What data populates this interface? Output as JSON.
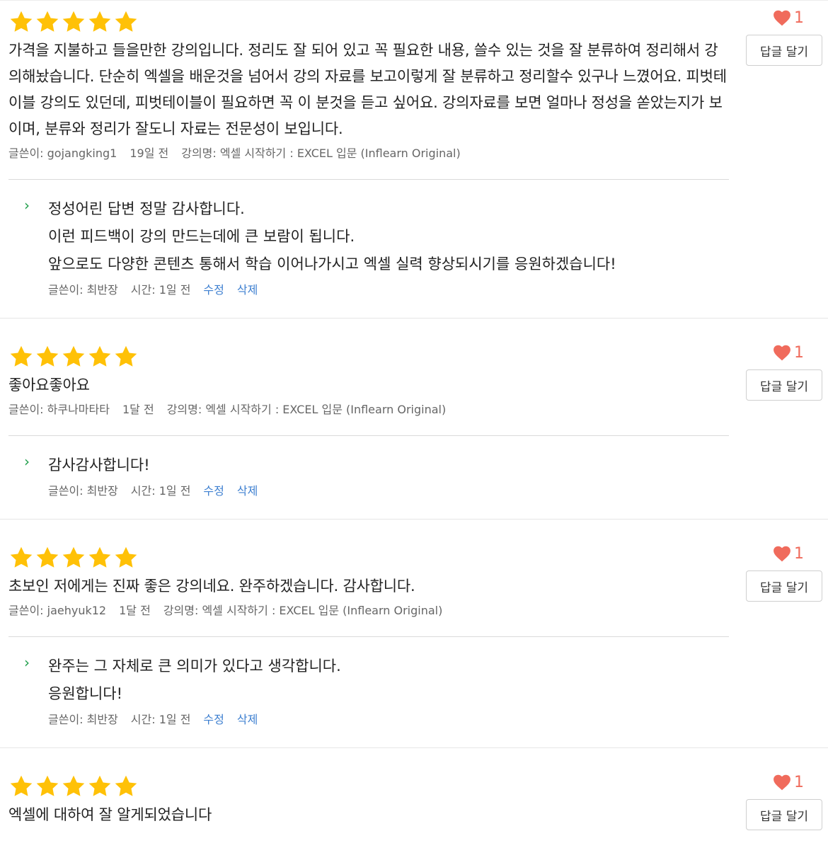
{
  "reviews": [
    {
      "rating": 5,
      "body": "가격을 지불하고 들을만한 강의입니다. 정리도 잘 되어 있고 꼭 필요한 내용, 쓸수 있는 것을 잘 분류하여 정리해서 강의해놨습니다. 단순히 엑셀을 배운것을 넘어서 강의 자료를 보고이렇게 잘 분류하고 정리할수 있구나 느꼈어요. 피벗테이블 강의도 있던데, 피벗테이블이 필요하면 꼭 이 분것을 듣고 싶어요. 강의자료를 보면 얼마나 정성을 쏟았는지가 보이며, 분류와 정리가 잘도니 자료는 전문성이 보입니다.",
      "author": "글쓴이: gojangking1",
      "time": "19일 전",
      "course": "강의명: 엑셀 시작하기 : EXCEL 입문 (Inflearn Original)",
      "likes": "1",
      "reply_button": "답글 달기",
      "reply": {
        "lines": [
          "정성어린 답변 정말 감사합니다.",
          "이런 피드백이 강의 만드는데에 큰 보람이 됩니다.",
          "앞으로도 다양한 콘텐츠 통해서 학습 이어나가시고 엑셀 실력 향상되시기를 응원하겠습니다!"
        ],
        "author": "글쓴이: 최반장",
        "time": "시간: 1일 전",
        "edit": "수정",
        "delete": "삭제"
      }
    },
    {
      "rating": 5,
      "body": "좋아요좋아요",
      "author": "글쓴이: 하쿠나마타타",
      "time": "1달 전",
      "course": "강의명: 엑셀 시작하기 : EXCEL 입문 (Inflearn Original)",
      "likes": "1",
      "reply_button": "답글 달기",
      "reply": {
        "lines": [
          "감사감사합니다!"
        ],
        "author": "글쓴이: 최반장",
        "time": "시간: 1일 전",
        "edit": "수정",
        "delete": "삭제"
      }
    },
    {
      "rating": 5,
      "body": "초보인 저에게는 진짜 좋은 강의네요. 완주하겠습니다. 감사합니다.",
      "author": "글쓴이: jaehyuk12",
      "time": "1달 전",
      "course": "강의명: 엑셀 시작하기 : EXCEL 입문 (Inflearn Original)",
      "likes": "1",
      "reply_button": "답글 달기",
      "reply": {
        "lines": [
          "완주는 그 자체로 큰 의미가 있다고 생각합니다.",
          "응원합니다!"
        ],
        "author": "글쓴이: 최반장",
        "time": "시간: 1일 전",
        "edit": "수정",
        "delete": "삭제"
      }
    },
    {
      "rating": 5,
      "body": "엑셀에 대하여 잘 알게되었습니다",
      "likes": "1",
      "reply_button": "답글 달기"
    }
  ],
  "colors": {
    "star": "#FFC107",
    "heart": "#F06B5C",
    "reply_arrow": "#1E9E4A",
    "action_link": "#3D7FD0"
  },
  "icons": {
    "star": "star-icon",
    "heart": "heart-icon",
    "reply_arrow": "chevron-right-icon"
  }
}
